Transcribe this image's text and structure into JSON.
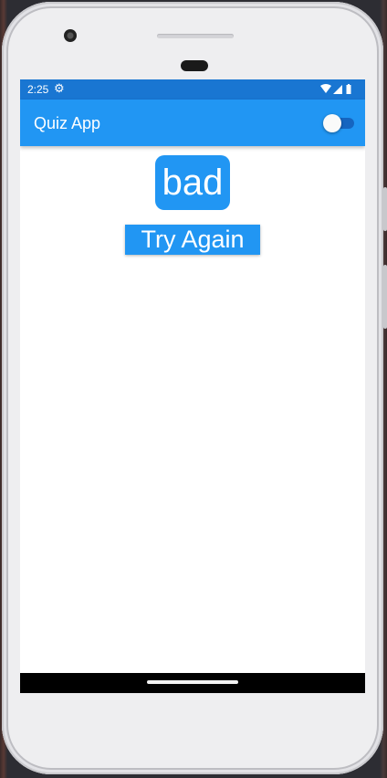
{
  "status_bar": {
    "time": "2:25",
    "icons": [
      "gear-icon",
      "wifi-icon",
      "cell-signal-icon",
      "battery-icon"
    ]
  },
  "app_bar": {
    "title": "Quiz App",
    "theme_toggle": {
      "on": false
    }
  },
  "quiz_result": {
    "result_text": "bad",
    "try_again_label": "Try Again"
  },
  "colors": {
    "primary": "#2196f3",
    "primary_dark": "#1976d2",
    "toggle_track": "#1565c0",
    "background": "#ffffff",
    "on_primary": "#ffffff"
  }
}
